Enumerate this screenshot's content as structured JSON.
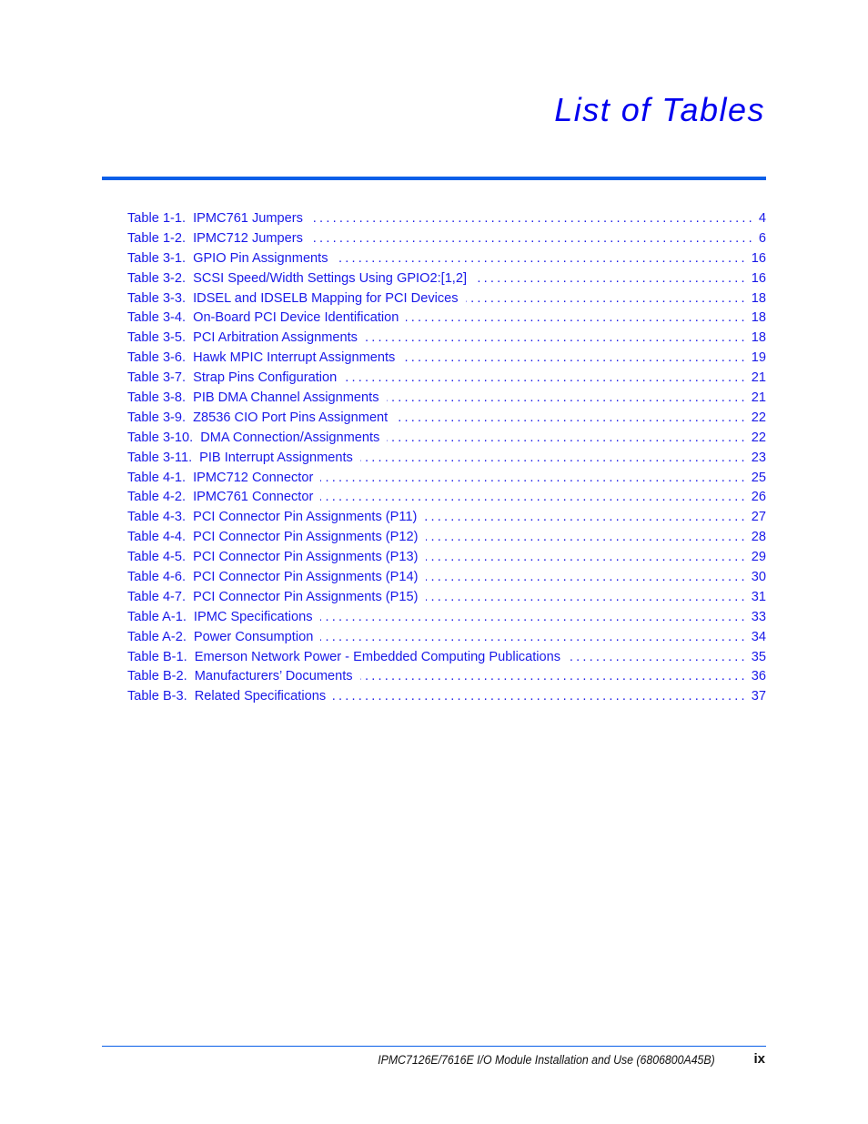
{
  "page": {
    "title": "List of Tables",
    "footer_text": "IPMC7126E/7616E I/O Module Installation and Use (6806800A45B)",
    "page_number": "ix"
  },
  "colors": {
    "link": "#1a1ae8",
    "accent_rule": "#0a5fe8"
  },
  "entries": [
    {
      "num": "Table 1-1.",
      "title": "IPMC761 Jumpers",
      "page": "4"
    },
    {
      "num": "Table 1-2.",
      "title": "IPMC712 Jumpers",
      "page": "6"
    },
    {
      "num": "Table 3-1.",
      "title": "GPIO Pin Assignments",
      "page": "16"
    },
    {
      "num": "Table 3-2.",
      "title": "SCSI Speed/Width Settings Using GPIO2:[1,2]",
      "page": "16"
    },
    {
      "num": "Table 3-3.",
      "title": "IDSEL and IDSELB Mapping for PCI Devices",
      "page": "18"
    },
    {
      "num": "Table 3-4.",
      "title": "On-Board PCI Device Identification",
      "page": "18"
    },
    {
      "num": "Table 3-5.",
      "title": "PCI Arbitration Assignments",
      "page": "18"
    },
    {
      "num": "Table 3-6.",
      "title": "Hawk MPIC Interrupt Assignments",
      "page": "19"
    },
    {
      "num": "Table 3-7.",
      "title": "Strap Pins Configuration",
      "page": "21"
    },
    {
      "num": "Table 3-8.",
      "title": "PIB DMA Channel Assignments",
      "page": "21"
    },
    {
      "num": "Table 3-9.",
      "title": "Z8536 CIO Port Pins Assignment",
      "page": "22"
    },
    {
      "num": "Table 3-10.",
      "title": "DMA Connection/Assignments",
      "page": "22"
    },
    {
      "num": "Table 3-11.",
      "title": "PIB Interrupt Assignments",
      "page": "23"
    },
    {
      "num": "Table 4-1.",
      "title": "IPMC712 Connector",
      "page": "25"
    },
    {
      "num": "Table 4-2.",
      "title": "IPMC761 Connector",
      "page": "26"
    },
    {
      "num": "Table 4-3.",
      "title": "PCI Connector Pin Assignments (P11)",
      "page": "27"
    },
    {
      "num": "Table 4-4.",
      "title": "PCI Connector Pin Assignments (P12)",
      "page": "28"
    },
    {
      "num": "Table 4-5.",
      "title": "PCI Connector Pin Assignments (P13)",
      "page": "29"
    },
    {
      "num": "Table 4-6.",
      "title": "PCI Connector Pin Assignments (P14)",
      "page": "30"
    },
    {
      "num": "Table 4-7.",
      "title": "PCI Connector Pin Assignments (P15)",
      "page": "31"
    },
    {
      "num": "Table A-1.",
      "title": "IPMC Specifications",
      "page": "33"
    },
    {
      "num": "Table A-2.",
      "title": "Power Consumption",
      "page": "34"
    },
    {
      "num": "Table B-1.",
      "title": "Emerson Network Power - Embedded Computing Publications",
      "page": "35"
    },
    {
      "num": "Table B-2.",
      "title": "Manufacturers’ Documents",
      "page": "36"
    },
    {
      "num": "Table B-3.",
      "title": "Related Specifications",
      "page": "37"
    }
  ]
}
